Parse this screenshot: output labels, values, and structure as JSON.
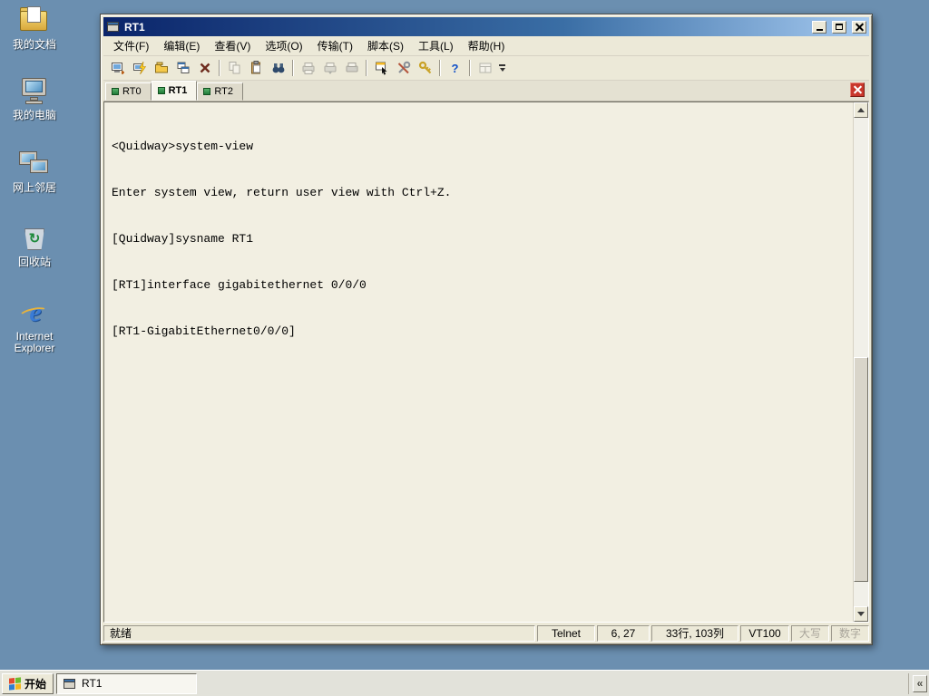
{
  "colors": {
    "desktop_background": "#6B8FB0",
    "titlebar_gradient_left": "#0A246A",
    "titlebar_gradient_right": "#A6CAF0",
    "terminal_background": "#F2EFE2",
    "tab_close_red": "#C9372C"
  },
  "desktop": {
    "icons": [
      {
        "name": "my-documents",
        "label": "我的文档"
      },
      {
        "name": "my-computer",
        "label": "我的电脑"
      },
      {
        "name": "network-places",
        "label": "网上邻居"
      },
      {
        "name": "recycle-bin",
        "label": "回收站"
      },
      {
        "name": "internet-explorer",
        "label": "Internet Explorer"
      }
    ],
    "recycle_glyph": "↻",
    "ie_glyph": "e"
  },
  "window": {
    "title": "RT1",
    "control_icons": [
      "minimize-icon",
      "maximize-icon",
      "close-icon"
    ],
    "menu": [
      "文件(F)",
      "编辑(E)",
      "查看(V)",
      "选项(O)",
      "传输(T)",
      "脚本(S)",
      "工具(L)",
      "帮助(H)"
    ],
    "toolbar_icons": [
      "connect-icon",
      "quick-connect-icon",
      "session-manager-icon",
      "clone-session-icon",
      "disconnect-icon",
      "copy-icon",
      "paste-icon",
      "find-icon",
      "send-file-icon",
      "receive-file-icon",
      "print-icon",
      "session-properties-icon",
      "global-options-icon",
      "keygen-icon",
      "help-icon",
      "tab-view-icon",
      "toolbar-overflow-icon"
    ],
    "help_glyph": "?",
    "tabs": [
      {
        "label": "RT0",
        "active": false
      },
      {
        "label": "RT1",
        "active": true
      },
      {
        "label": "RT2",
        "active": false
      }
    ],
    "terminal_lines": [
      "<Quidway>system-view",
      "Enter system view, return user view with Ctrl+Z.",
      "[Quidway]sysname RT1",
      "[RT1]interface gigabitethernet 0/0/0",
      "[RT1-GigabitEthernet0/0/0]"
    ],
    "statusbar": {
      "ready": "就绪",
      "protocol": "Telnet",
      "cursor_pos": "6, 27",
      "dimensions": "33行, 103列",
      "emulation": "VT100",
      "caps_lock": "大写",
      "num_lock": "数字"
    }
  },
  "taskbar": {
    "start_label": "开始",
    "tasks": [
      {
        "label": "RT1"
      }
    ],
    "tray_chevron": "«"
  }
}
